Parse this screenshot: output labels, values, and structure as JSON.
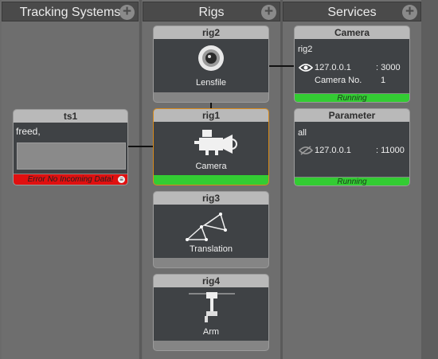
{
  "columns": {
    "tracking": {
      "title": "Tracking Systems"
    },
    "rigs": {
      "title": "Rigs"
    },
    "services": {
      "title": "Services"
    }
  },
  "tracking_systems": [
    {
      "name": "ts1",
      "info": "freed,",
      "error": "Error No Incoming Data!",
      "error_color": "#e01010"
    }
  ],
  "rigs": [
    {
      "name": "rig2",
      "label": "Lensfile",
      "icon": "lens-icon"
    },
    {
      "name": "rig1",
      "label": "Camera",
      "icon": "camera-icon",
      "selected": true,
      "status_color": "#33cc33"
    },
    {
      "name": "rig3",
      "label": "Translation",
      "icon": "translation-icon"
    },
    {
      "name": "rig4",
      "label": "Arm",
      "icon": "arm-icon"
    }
  ],
  "services": [
    {
      "name": "Camera",
      "rig": "rig2",
      "ip": "127.0.0.1",
      "port": ": 3000",
      "camera_label": "Camera No.",
      "camera_no": "1",
      "status": "Running",
      "icon": "eye-icon"
    },
    {
      "name": "Parameter",
      "rig": "all",
      "ip": "127.0.0.1",
      "port": ": 11000",
      "status": "Running",
      "icon": "eye-off-icon"
    }
  ],
  "colors": {
    "running": "#33cc33",
    "error": "#e01010",
    "selected_border": "#d88a1a"
  }
}
